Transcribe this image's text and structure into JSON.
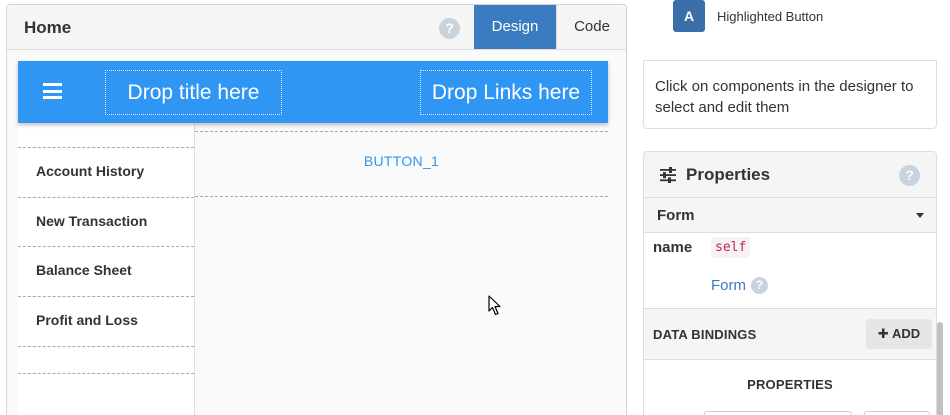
{
  "designer": {
    "title": "Home",
    "help_glyph": "?",
    "tabs": [
      {
        "label": "Design",
        "active": true
      },
      {
        "label": "Code",
        "active": false
      }
    ],
    "app_bar": {
      "menu_icon": "hamburger-menu-icon",
      "drop_title": "Drop title here",
      "drop_links": "Drop Links here",
      "color": "#2f96f3"
    },
    "sidebar": {
      "items": [
        {
          "label": "Account History"
        },
        {
          "label": "New Transaction"
        },
        {
          "label": "Balance Sheet"
        },
        {
          "label": "Profit and Loss"
        }
      ]
    },
    "content": {
      "button_label": "BUTTON_1"
    }
  },
  "palette": {
    "component_icon_letter": "A",
    "component_label": "Highlighted Button"
  },
  "info": {
    "text": "Click on components in the designer to select and edit them"
  },
  "properties": {
    "title": "Properties",
    "icon": "sliders-icon",
    "help_glyph": "?",
    "section": "Form",
    "name_label": "name",
    "name_value": "self",
    "type_link": "Form",
    "type_help_glyph": "?",
    "bindings_label": "DATA BINDINGS",
    "add_label": "ADD",
    "add_icon": "plus-icon",
    "properties_heading": "PROPERTIES"
  },
  "colors": {
    "accent": "#3a7cbf",
    "app_bar": "#2f96f3",
    "code_red": "#c7254e"
  }
}
